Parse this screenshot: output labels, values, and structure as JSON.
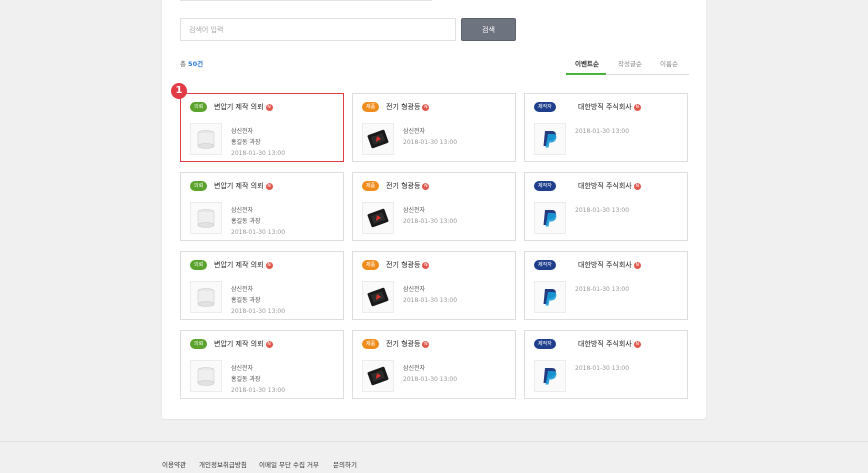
{
  "search": {
    "placeholder": "검색어 입력",
    "button_label": "검색"
  },
  "summary": {
    "total_prefix": "총 ",
    "total_count": "50건"
  },
  "sort_options": [
    "이벤트순",
    "작성글순",
    "이름순"
  ],
  "step_marker": "1",
  "columns": [
    {
      "badge": "의뢰",
      "badge_color": "#5ba32d",
      "title": "변압기 제작 의뢰",
      "company": "삼신전자",
      "person": "홍길동 과장",
      "date": "2018-01-30 13:00",
      "thumb_icon": "transformer-image"
    },
    {
      "badge": "제품",
      "badge_color": "#f08c1c",
      "title": "전기 형광등",
      "company": "삼신전자",
      "person": "",
      "date": "2018-01-30 13:00",
      "thumb_icon": "device-image"
    },
    {
      "badge": "제작자",
      "badge_color": "#1f3f8c",
      "title": "대한방직 주식회사",
      "company": "",
      "person": "",
      "date": "2018-01-30 13:00",
      "thumb_icon": "paypal-logo"
    }
  ],
  "new_badge": "N",
  "footer": {
    "links": [
      "이용약관",
      "개인정보취급방침",
      "이메일 무단 수집 거부",
      "문의하기"
    ]
  }
}
